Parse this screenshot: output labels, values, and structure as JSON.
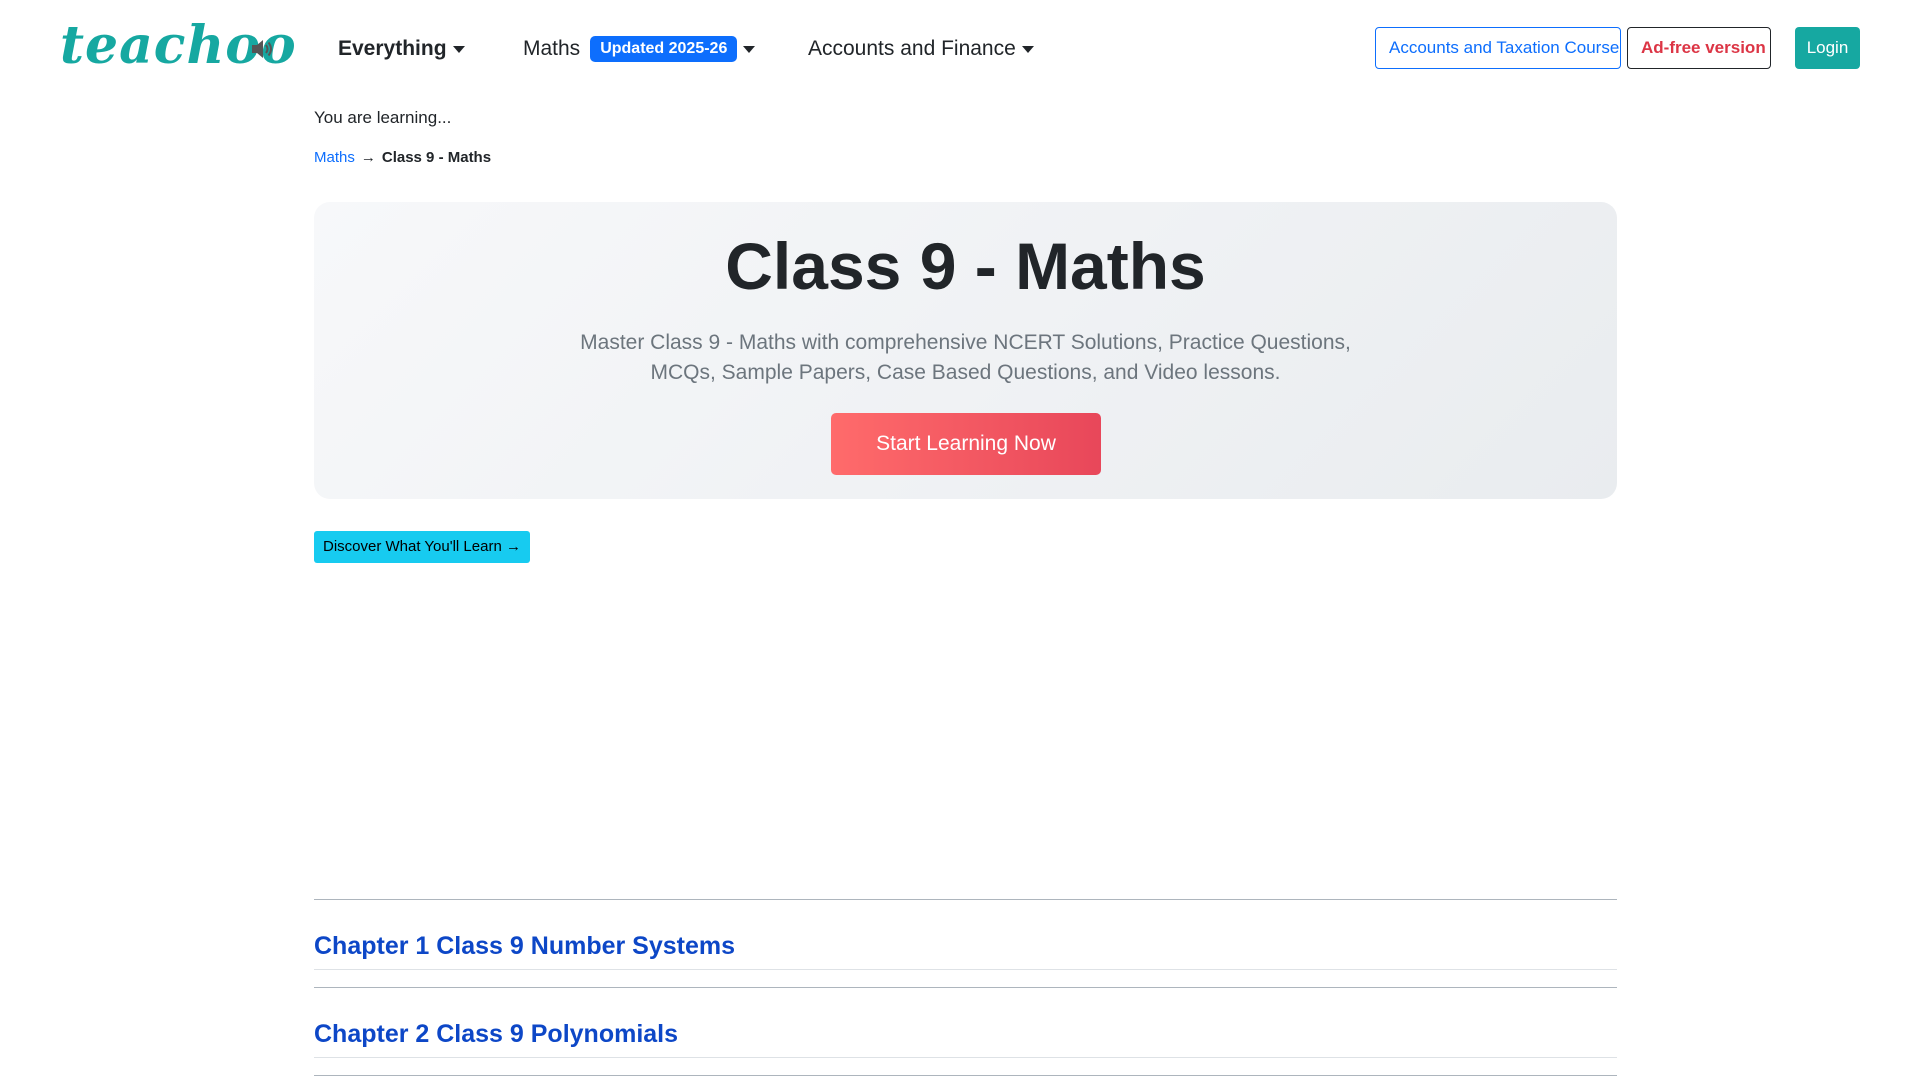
{
  "brand": {
    "logo_text": "teachoo"
  },
  "nav": {
    "items": [
      {
        "label": "Everything"
      },
      {
        "label": "Maths",
        "badge": "Updated 2025-26"
      },
      {
        "label": "Accounts and Finance"
      }
    ],
    "course_button": "Accounts and Taxation Course",
    "adfree_button": "Ad-free version",
    "login_button": "Login"
  },
  "page": {
    "learning_label": "You are learning...",
    "breadcrumb": {
      "link": "Maths",
      "separator": "→",
      "current": "Class 9 - Maths"
    },
    "hero": {
      "title": "Class 9 - Maths",
      "subtitle": "Master Class 9 - Maths with comprehensive NCERT Solutions, Practice Questions, MCQs, Sample Papers, Case Based Questions, and Video lessons.",
      "cta": "Start Learning Now"
    },
    "discover_button": "Discover What You'll Learn →",
    "chapters": [
      {
        "title": "Chapter 1 Class 9 Number Systems"
      },
      {
        "title": "Chapter 2 Class 9 Polynomials"
      }
    ]
  },
  "colors": {
    "brand": "#16a8a1",
    "link": "#0d6efd",
    "chapter_link": "#0d47c7",
    "adfree": "#dc3545",
    "cta_start": "#ff6b6b",
    "cta_end": "#e8475a",
    "discover": "#17cbf0"
  },
  "icons": {
    "speaker": "speaker-volume-icon",
    "dropdown": "caret-down-icon"
  }
}
